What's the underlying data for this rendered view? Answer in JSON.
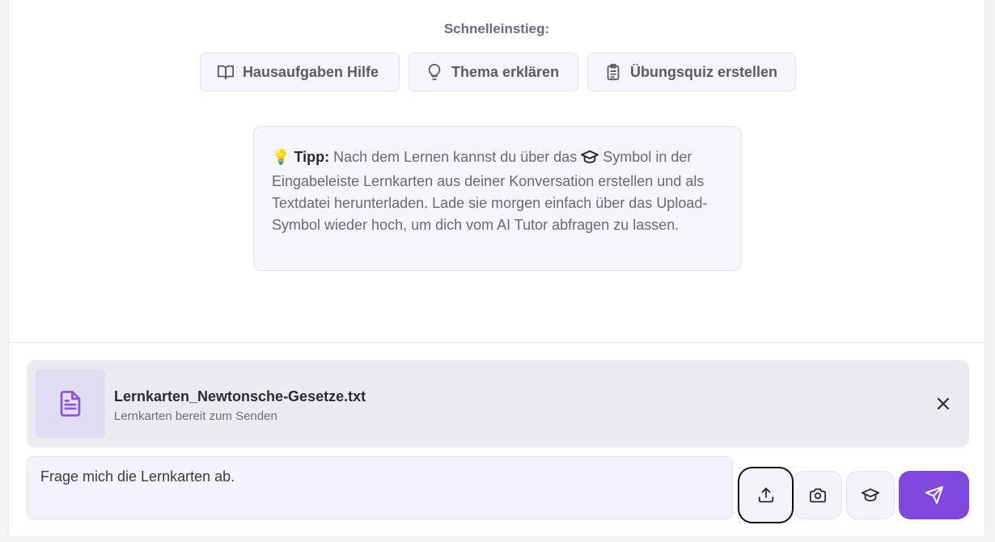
{
  "quick_start": {
    "title": "Schnelleinstieg:",
    "buttons": [
      {
        "label": "Hausaufgaben Hilfe",
        "icon": "book-open-icon"
      },
      {
        "label": "Thema erklären",
        "icon": "lightbulb-icon"
      },
      {
        "label": "Übungsquiz erstellen",
        "icon": "clipboard-icon"
      }
    ]
  },
  "tip": {
    "emoji": "💡",
    "label": "Tipp:",
    "text_before": " Nach dem Lernen kannst du über das ",
    "text_after": " Symbol in der Eingabeleiste Lernkarten aus deiner Konversation erstellen und als Textdatei herunterladen. Lade sie morgen einfach über das Upload-Symbol wieder hoch, um dich vom AI Tutor abfragen zu lassen."
  },
  "attachment": {
    "file_name": "Lernkarten_Newtonsche-Gesetze.txt",
    "status": "Lernkarten bereit zum Senden"
  },
  "composer": {
    "value": "Frage mich die Lernkarten ab."
  },
  "colors": {
    "accent": "#7f47dc",
    "file_icon": "#8a55d8"
  }
}
